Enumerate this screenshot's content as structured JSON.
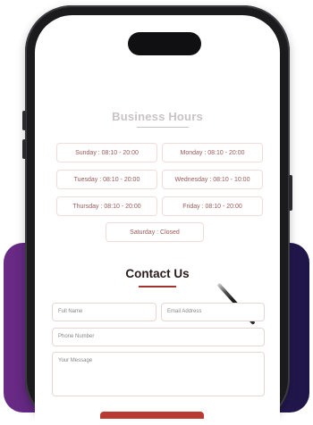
{
  "business_hours": {
    "title": "Business Hours",
    "days": [
      {
        "label": "Sunday : 08:10 - 20:00"
      },
      {
        "label": "Monday : 08:10 - 20:00"
      },
      {
        "label": "Tuesday : 08:10 - 20:00"
      },
      {
        "label": "Wednesday : 08:10 - 10:00"
      },
      {
        "label": "Thursday : 08:10 - 20:00"
      },
      {
        "label": "Friday : 08:10 - 20:00"
      },
      {
        "label": "Saturday : Closed"
      }
    ]
  },
  "contact": {
    "title": "Contact Us",
    "full_name_placeholder": "Full Name",
    "email_placeholder": "Email Address",
    "phone_placeholder": "Phone Number",
    "message_placeholder": "Your Message"
  },
  "colors": {
    "accent": "#b83a32",
    "backdrop_start": "#6a2a86",
    "backdrop_end": "#1e1548"
  }
}
